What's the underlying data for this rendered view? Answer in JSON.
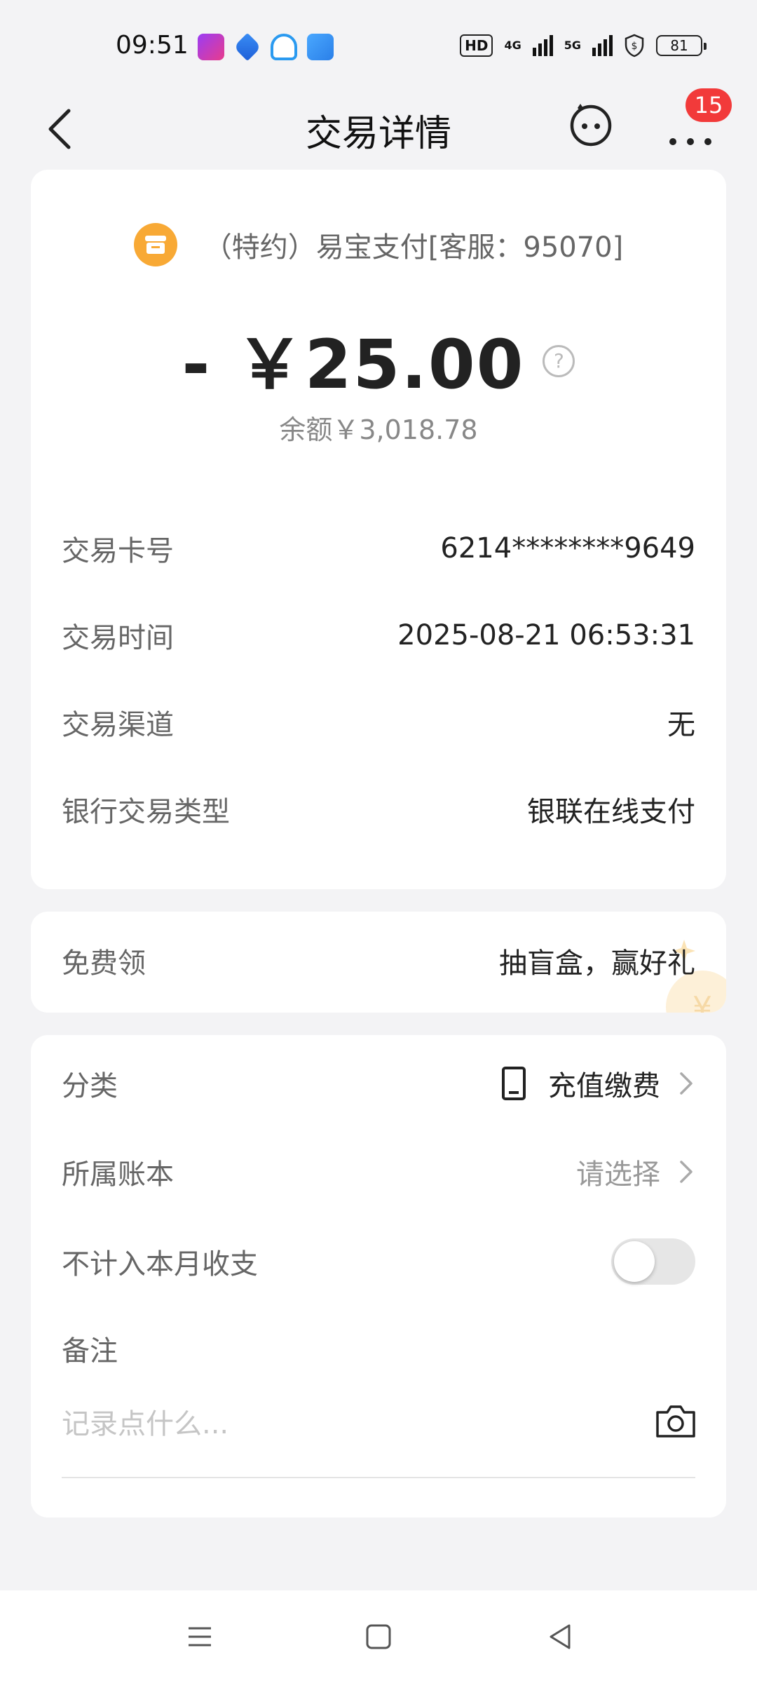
{
  "status_bar": {
    "time": "09:51",
    "hd": "HD",
    "net1": "4G",
    "net2": "5G",
    "battery": "81"
  },
  "header": {
    "title": "交易详情",
    "badge_count": "15"
  },
  "transaction": {
    "merchant": "（特约）易宝支付[客服：95070]",
    "amount": "- ￥25.00",
    "balance": "余额￥3,018.78",
    "details": [
      {
        "label": "交易卡号",
        "value": "6214********9649"
      },
      {
        "label": "交易时间",
        "value": "2025-08-21 06:53:31"
      },
      {
        "label": "交易渠道",
        "value": "无"
      },
      {
        "label": "银行交易类型",
        "value": "银联在线支付"
      }
    ]
  },
  "promo": {
    "label": "免费领",
    "value": "抽盲盒，赢好礼"
  },
  "settings": {
    "category_label": "分类",
    "category_value": "充值缴费",
    "account_label": "所属账本",
    "account_value": "请选择",
    "exclude_label": "不计入本月收支",
    "exclude_on": false,
    "note_label": "备注",
    "note_placeholder": "记录点什么..."
  }
}
